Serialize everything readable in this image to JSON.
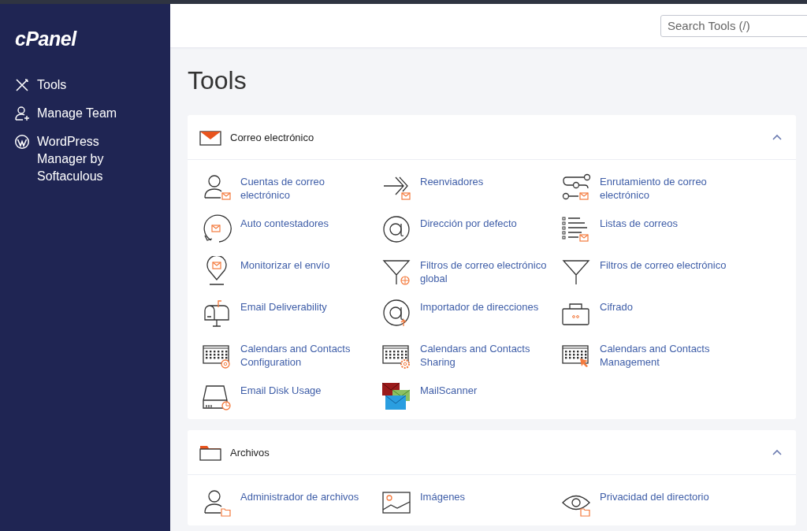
{
  "logo": "cPanel",
  "nav": [
    {
      "label": "Tools"
    },
    {
      "label": "Manage Team"
    },
    {
      "label": "WordPress Manager by Softaculous"
    }
  ],
  "search": {
    "placeholder": "Search Tools (/)"
  },
  "page_title": "Tools",
  "sections": [
    {
      "title": "Correo electrónico",
      "expanded": true,
      "tools": [
        "Cuentas de correo electrónico",
        "Reenviadores",
        "Enrutamiento de correo electrónico",
        "Auto contestadores",
        "Dirección por defecto",
        "Listas de correos",
        "Monitorizar el envío",
        "Filtros de correo electrónico global",
        "Filtros de correo electrónico",
        "Email Deliverability",
        "Importador de direcciones",
        "Cifrado",
        "Calendars and Contacts Configuration",
        "Calendars and Contacts Sharing",
        "Calendars and Contacts Management",
        "Email Disk Usage",
        "MailScanner"
      ]
    },
    {
      "title": "Archivos",
      "expanded": true,
      "tools": [
        "Administrador de archivos",
        "Imágenes",
        "Privacidad del directorio"
      ]
    }
  ]
}
